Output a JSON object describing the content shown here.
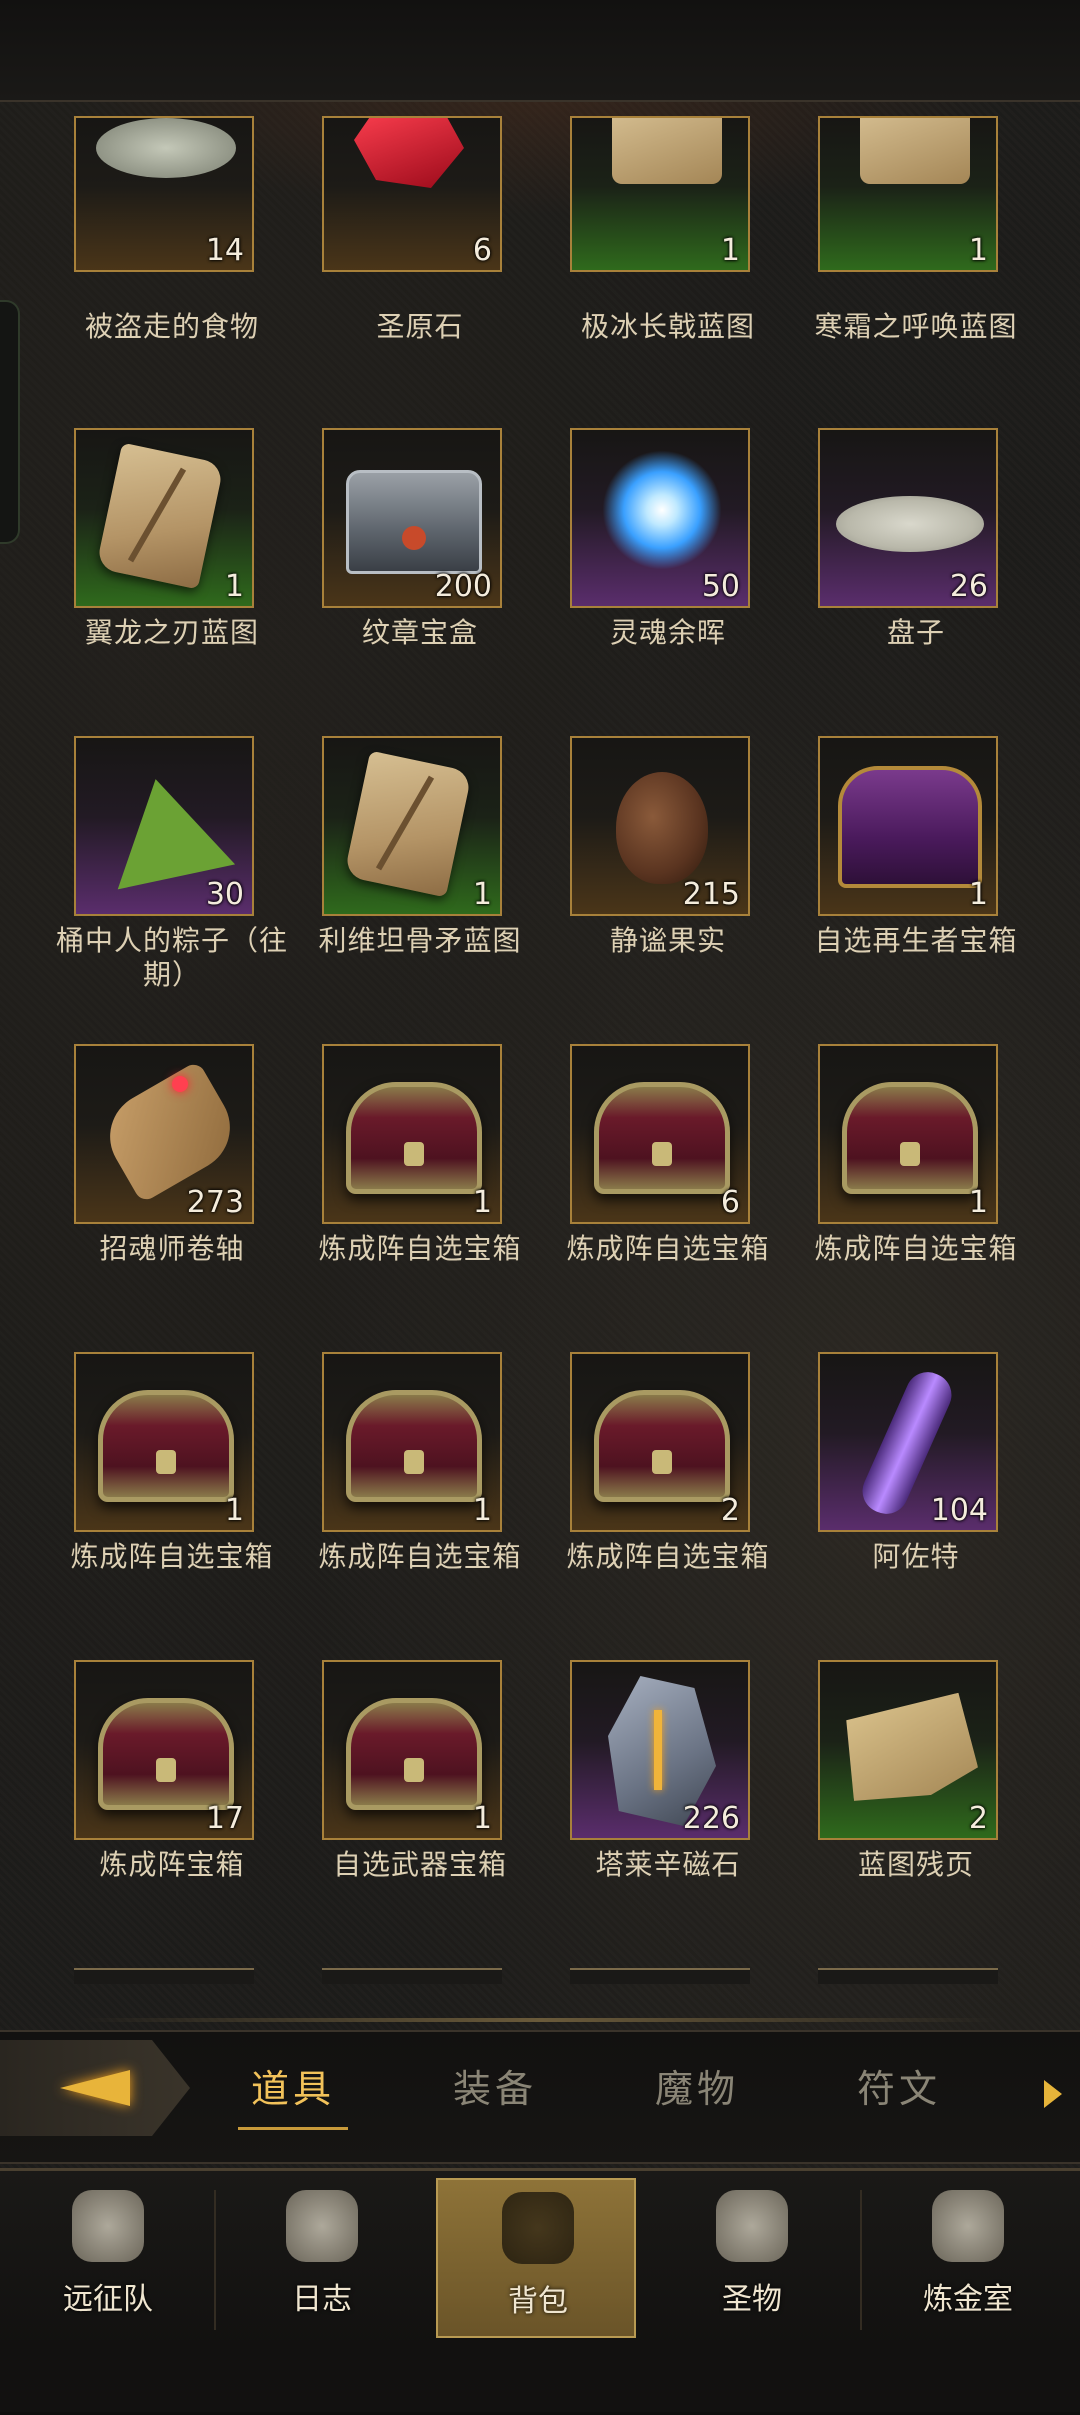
{
  "inventory": {
    "rows": [
      [
        {
          "name": "被盗走的食物",
          "count": "14",
          "rarity": "brown",
          "icon": "food-plate-icon"
        },
        {
          "name": "圣原石",
          "count": "6",
          "rarity": "brown",
          "icon": "red-gem-icon"
        },
        {
          "name": "极冰长戟蓝图",
          "count": "1",
          "rarity": "green",
          "icon": "scroll-icon"
        },
        {
          "name": "寒霜之呼唤蓝图",
          "count": "1",
          "rarity": "green",
          "icon": "scroll-icon"
        }
      ],
      [
        {
          "name": "翼龙之刃蓝图",
          "count": "1",
          "rarity": "green",
          "icon": "scroll-icon"
        },
        {
          "name": "纹章宝盒",
          "count": "200",
          "rarity": "brown",
          "icon": "silver-chest-icon"
        },
        {
          "name": "灵魂余晖",
          "count": "50",
          "rarity": "purple",
          "icon": "soul-orb-icon"
        },
        {
          "name": "盘子",
          "count": "26",
          "rarity": "purple",
          "icon": "plate-icon"
        }
      ],
      [
        {
          "name": "桶中人的粽子（往期）",
          "count": "30",
          "rarity": "purple",
          "icon": "zongzi-icon"
        },
        {
          "name": "利维坦骨矛蓝图",
          "count": "1",
          "rarity": "green",
          "icon": "scroll-icon"
        },
        {
          "name": "静谧果实",
          "count": "215",
          "rarity": "brown",
          "icon": "pinecone-icon"
        },
        {
          "name": "自选再生者宝箱",
          "count": "1",
          "rarity": "brown",
          "icon": "purple-chest-icon"
        }
      ],
      [
        {
          "name": "招魂师卷轴",
          "count": "273",
          "rarity": "brown",
          "icon": "rolled-scroll-icon"
        },
        {
          "name": "炼成阵自选宝箱",
          "count": "1",
          "rarity": "brown",
          "icon": "chest-icon"
        },
        {
          "name": "炼成阵自选宝箱",
          "count": "6",
          "rarity": "brown",
          "icon": "chest-icon"
        },
        {
          "name": "炼成阵自选宝箱",
          "count": "1",
          "rarity": "brown",
          "icon": "chest-icon"
        }
      ],
      [
        {
          "name": "炼成阵自选宝箱",
          "count": "1",
          "rarity": "brown",
          "icon": "chest-icon"
        },
        {
          "name": "炼成阵自选宝箱",
          "count": "1",
          "rarity": "brown",
          "icon": "chest-icon"
        },
        {
          "name": "炼成阵自选宝箱",
          "count": "2",
          "rarity": "brown",
          "icon": "chest-icon"
        },
        {
          "name": "阿佐特",
          "count": "104",
          "rarity": "purple",
          "icon": "crystal-vial-icon"
        }
      ],
      [
        {
          "name": "炼成阵宝箱",
          "count": "17",
          "rarity": "brown",
          "icon": "chest-icon"
        },
        {
          "name": "自选武器宝箱",
          "count": "1",
          "rarity": "brown",
          "icon": "chest-icon"
        },
        {
          "name": "塔莱辛磁石",
          "count": "226",
          "rarity": "purple",
          "icon": "lodestone-icon"
        },
        {
          "name": "蓝图残页",
          "count": "2",
          "rarity": "green",
          "icon": "blueprint-page-icon"
        }
      ]
    ]
  },
  "category_tabs": {
    "items": [
      {
        "label": "道具",
        "active": true
      },
      {
        "label": "装备",
        "active": false
      },
      {
        "label": "魔物",
        "active": false
      },
      {
        "label": "符文",
        "active": false
      }
    ],
    "filter_icon": "filter-arrow-icon",
    "more_icon": "arrow-right-icon"
  },
  "bottom_nav": {
    "items": [
      {
        "label": "远征队",
        "icon": "viking-helmet-icon",
        "active": false
      },
      {
        "label": "日志",
        "icon": "journal-icon",
        "active": false
      },
      {
        "label": "背包",
        "icon": "backpack-icon",
        "active": true
      },
      {
        "label": "圣物",
        "icon": "relic-chalice-icon",
        "active": false
      },
      {
        "label": "炼金室",
        "icon": "alchemy-icon",
        "active": false
      }
    ]
  },
  "colors": {
    "accent": "#f2c25a",
    "tile_border": "#a8813a",
    "rarity_brown": "#4a3518",
    "rarity_green": "#2f6a1c",
    "rarity_purple": "#5a2d6c"
  }
}
